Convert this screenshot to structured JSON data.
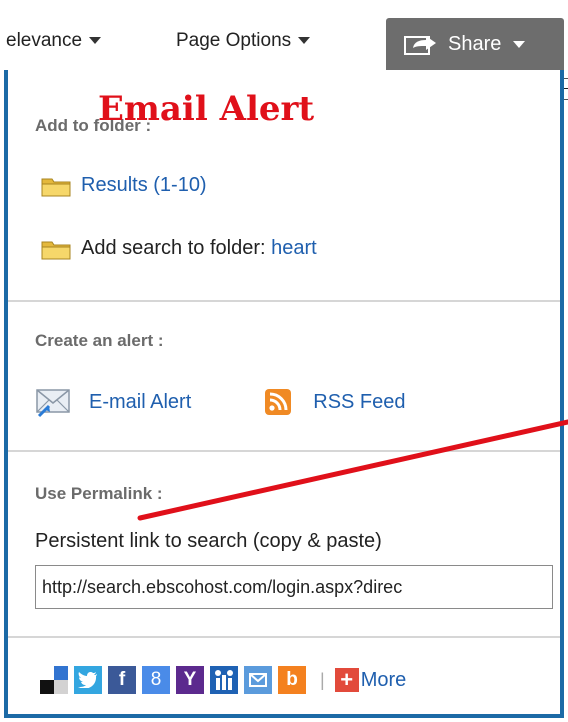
{
  "toolbar": {
    "sort_label": "elevance",
    "page_options_label": "Page Options",
    "share_label": "Share",
    "tooltip_text": "H"
  },
  "folder_section": {
    "title": "Add to folder :",
    "results_link": "Results (1-10)",
    "add_search_label": "Add search to folder:",
    "search_term_link": "heart"
  },
  "alert_section": {
    "title": "Create an alert :",
    "email_alert_link": "E-mail Alert",
    "rss_feed_link": "RSS Feed"
  },
  "permalink_section": {
    "title": "Use Permalink :",
    "description": "Persistent link to search (copy & paste)",
    "url_value": "http://search.ebscohost.com/login.aspx?direc"
  },
  "social_bar": {
    "icons": [
      "delicious-icon",
      "twitter-icon",
      "facebook-icon",
      "google-plus-icon",
      "yahoo-icon",
      "mendeley-icon",
      "email-share-icon",
      "blogger-icon"
    ],
    "more_label": "More"
  },
  "annotation": {
    "title": "Email Alert",
    "color": "#e0101a"
  },
  "colors": {
    "panel_border": "#1c6aa6",
    "link": "#1f5fae",
    "share_button": "#6d6d6d"
  }
}
